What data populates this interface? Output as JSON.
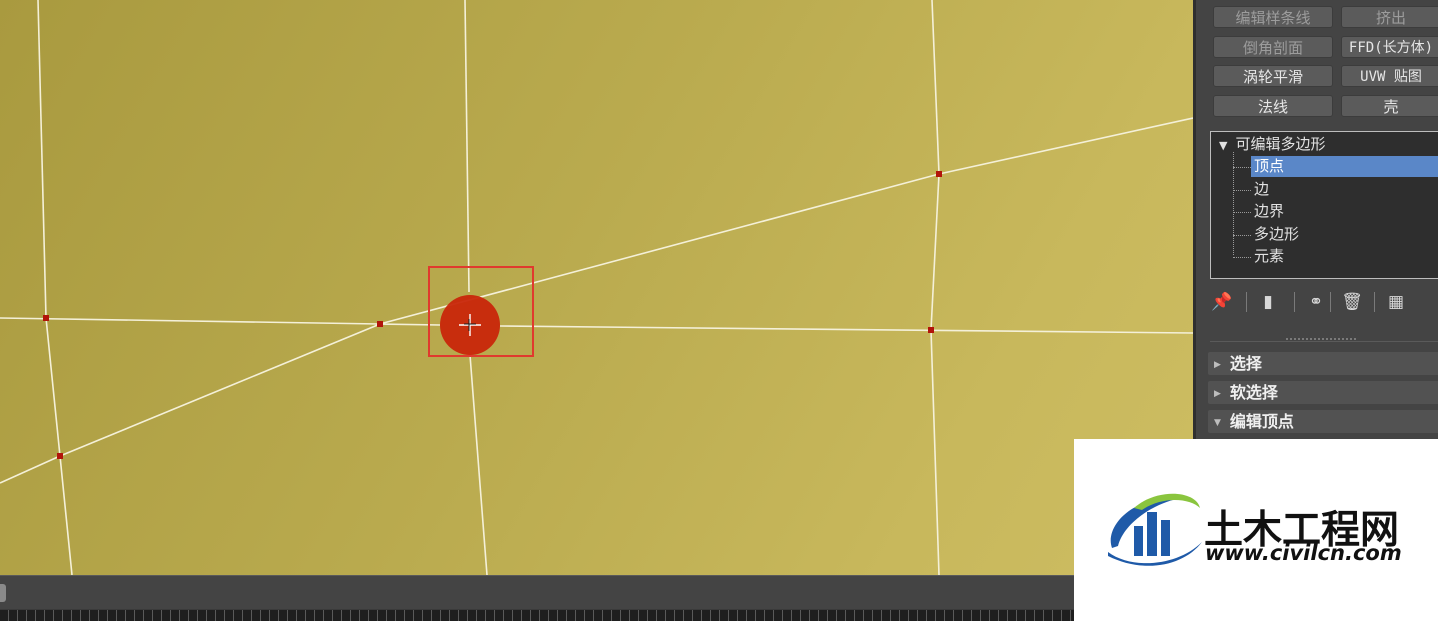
{
  "modifier_buttons": [
    {
      "label": "编辑样条线",
      "enabled": false
    },
    {
      "label": "挤出",
      "enabled": false
    },
    {
      "label": "倒角剖面",
      "enabled": false
    },
    {
      "label": "FFD(长方体)",
      "enabled": true
    },
    {
      "label": "涡轮平滑",
      "enabled": true
    },
    {
      "label": "UVW 贴图",
      "enabled": true
    },
    {
      "label": "法线",
      "enabled": true
    },
    {
      "label": "壳",
      "enabled": true
    }
  ],
  "modifier_stack": {
    "root": "可编辑多边形",
    "items": [
      {
        "label": "顶点",
        "selected": true
      },
      {
        "label": "边",
        "selected": false
      },
      {
        "label": "边界",
        "selected": false
      },
      {
        "label": "多边形",
        "selected": false
      },
      {
        "label": "元素",
        "selected": false
      }
    ]
  },
  "stack_tools": [
    {
      "icon": "pin-stack-icon",
      "glyph": "📌"
    },
    {
      "icon": "show-end-result-icon",
      "glyph": "▮"
    },
    {
      "icon": "make-unique-icon",
      "glyph": "⚭"
    },
    {
      "icon": "remove-modifier-icon",
      "glyph": "🗑"
    },
    {
      "icon": "configure-modifier-sets-icon",
      "glyph": "▦"
    }
  ],
  "rollouts": [
    {
      "label": "选择",
      "expanded": false
    },
    {
      "label": "软选择",
      "expanded": false
    },
    {
      "label": "编辑顶点",
      "expanded": true
    }
  ],
  "watermark": {
    "name": "土木工程网",
    "url": "www.civilcn.com"
  },
  "colors": {
    "viewport": "#b6a74b",
    "edge": "#f4f0d8",
    "vertex": "#b2140a",
    "highlight_marker": "#c8260a",
    "highlight_box": "#e03a2e",
    "selection": "#5a87c8",
    "logo_blue": "#1f5aa8",
    "logo_green": "#8ac53e"
  }
}
